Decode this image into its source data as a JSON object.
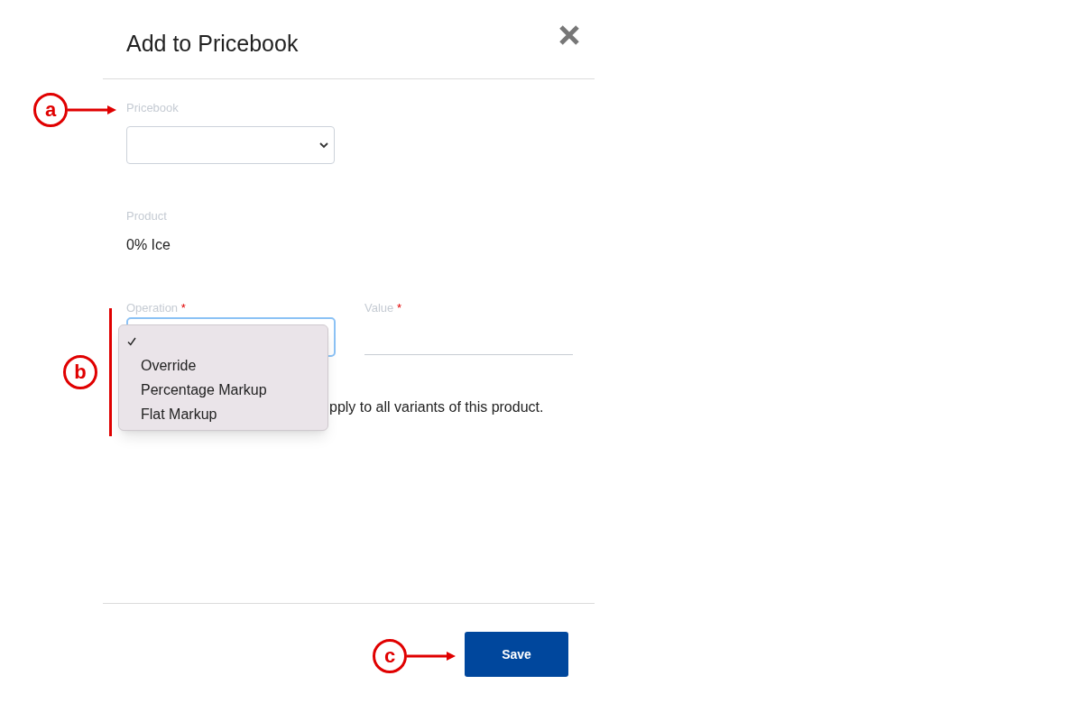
{
  "dialog": {
    "title": "Add to Pricebook"
  },
  "pricebook": {
    "label": "Pricebook"
  },
  "product": {
    "label": "Product",
    "value": "0% Ice"
  },
  "operation": {
    "label": "Operation",
    "required_mark": "*",
    "open": true,
    "options": [
      {
        "selected": true
      },
      {
        "label": "Override",
        "selected": false
      },
      {
        "label": "Percentage Markup",
        "selected": false
      },
      {
        "label": "Flat Markup",
        "selected": false
      }
    ]
  },
  "value": {
    "label": "Value",
    "required_mark": "*"
  },
  "variants_note": "pply to all variants of this product.",
  "footer": {
    "save": "Save"
  },
  "callouts": [
    {
      "letter": "a",
      "kind": "arrow"
    },
    {
      "letter": "b",
      "kind": "bracket"
    },
    {
      "letter": "c",
      "kind": "arrow"
    }
  ]
}
